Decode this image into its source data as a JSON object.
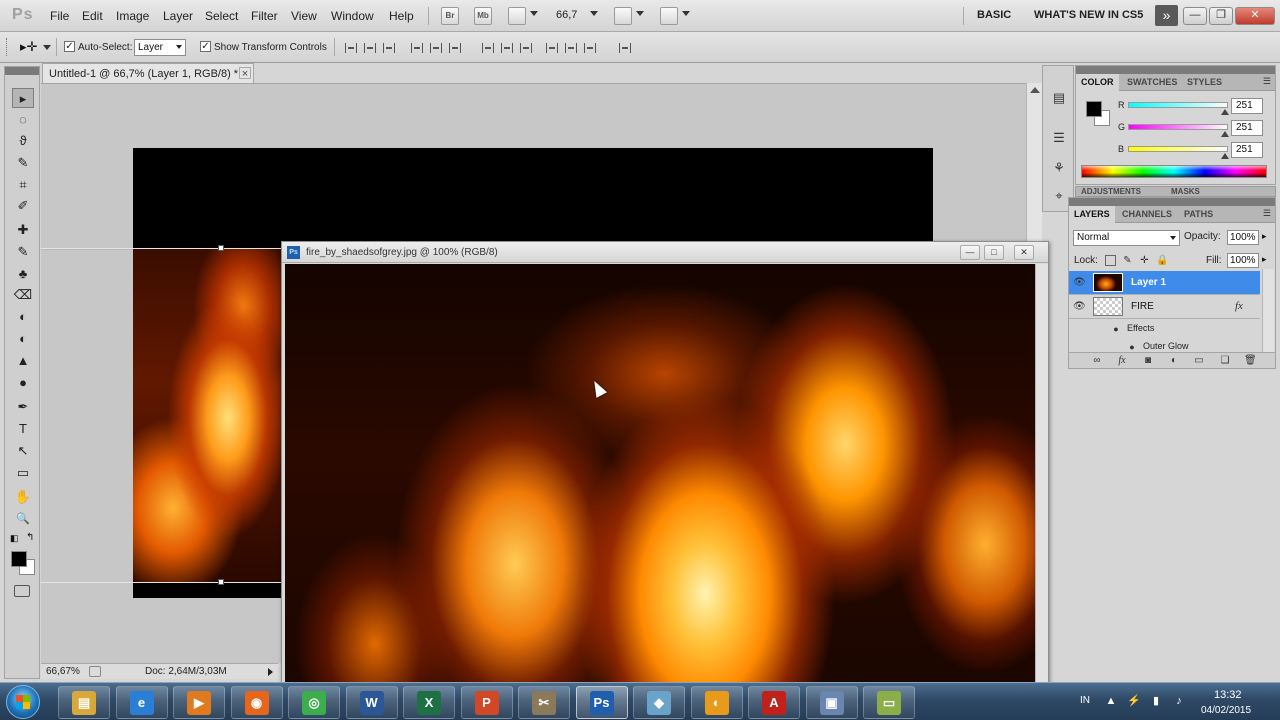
{
  "app": {
    "logo": "Ps"
  },
  "menu": [
    "File",
    "Edit",
    "Image",
    "Layer",
    "Select",
    "Filter",
    "View",
    "Window",
    "Help"
  ],
  "menubar": {
    "bridge_btn": "Br",
    "minibridge_btn": "Mb",
    "zoom": "66,7",
    "workspace_basic": "BASIC",
    "workspace_new": "WHAT'S NEW IN CS5",
    "more_icon": "»"
  },
  "options": {
    "auto_select_label": "Auto-Select:",
    "auto_select_value": "Layer",
    "transform_label": "Show Transform Controls",
    "checkmark": "✓"
  },
  "doc1": {
    "tab_title": "Untitled-1 @ 66,7% (Layer 1, RGB/8) *",
    "close": "×",
    "status_zoom": "66,67%",
    "status_doc": "Doc: 2,64M/3,03M"
  },
  "doc2": {
    "ps_icon": "Ps",
    "title": "fire_by_shaedsofgrey.jpg @ 100% (RGB/8)",
    "min": "—",
    "max": "□",
    "close": "✕"
  },
  "tools": [
    "▸",
    "◌",
    "ϑ",
    "✎",
    "⌗",
    "✐",
    "✚",
    "✎",
    "♣",
    "⌫",
    "◐",
    "▲",
    "●",
    "✒",
    "T",
    "↖",
    "▭",
    "✋",
    "🔍"
  ],
  "color_panel": {
    "tabs": [
      "COLOR",
      "SWATCHES",
      "STYLES"
    ],
    "channels": [
      {
        "label": "R",
        "value": "251",
        "gradient": "#00ffff"
      },
      {
        "label": "G",
        "value": "251",
        "gradient": "#ff00ff"
      },
      {
        "label": "B",
        "value": "251",
        "gradient": "#ffff00"
      }
    ],
    "adjust_tabs": [
      "ADJUSTMENTS",
      "MASKS"
    ]
  },
  "layers_panel": {
    "tabs": [
      "LAYERS",
      "CHANNELS",
      "PATHS"
    ],
    "blend_mode": "Normal",
    "opacity_label": "Opacity:",
    "opacity_value": "100%",
    "lock_label": "Lock:",
    "fill_label": "Fill:",
    "fill_value": "100%",
    "layers": [
      {
        "name": "Layer 1",
        "selected": true
      },
      {
        "name": "FIRE",
        "fx": "fx"
      }
    ],
    "effects_label": "Effects",
    "outer_glow_label": "Outer Glow"
  },
  "taskbar": {
    "apps": [
      {
        "name": "file-explorer",
        "glyph": "▤",
        "color": "#d9a83a"
      },
      {
        "name": "internet-explorer",
        "glyph": "e",
        "color": "#2a7fd4"
      },
      {
        "name": "media-player",
        "glyph": "▶",
        "color": "#e07a1f"
      },
      {
        "name": "firefox",
        "glyph": "◉",
        "color": "#e8661c"
      },
      {
        "name": "chrome",
        "glyph": "◎",
        "color": "#3cae4d"
      },
      {
        "name": "word",
        "glyph": "W",
        "color": "#2b5797"
      },
      {
        "name": "excel",
        "glyph": "X",
        "color": "#1e7145"
      },
      {
        "name": "powerpoint",
        "glyph": "P",
        "color": "#d24726"
      },
      {
        "name": "tools",
        "glyph": "✂",
        "color": "#8a7a5a"
      },
      {
        "name": "photoshop",
        "glyph": "Ps",
        "color": "#1f5fad"
      },
      {
        "name": "notes",
        "glyph": "◆",
        "color": "#6aa3c9"
      },
      {
        "name": "clock-app",
        "glyph": "◐",
        "color": "#e89a1a"
      },
      {
        "name": "acrobat",
        "glyph": "A",
        "color": "#c0211b"
      },
      {
        "name": "virtualbox",
        "glyph": "▣",
        "color": "#6a86b0"
      },
      {
        "name": "notepad",
        "glyph": "▭",
        "color": "#8cae4a"
      }
    ],
    "lang": "IN",
    "time": "13:32",
    "date": "04/02/2015"
  }
}
